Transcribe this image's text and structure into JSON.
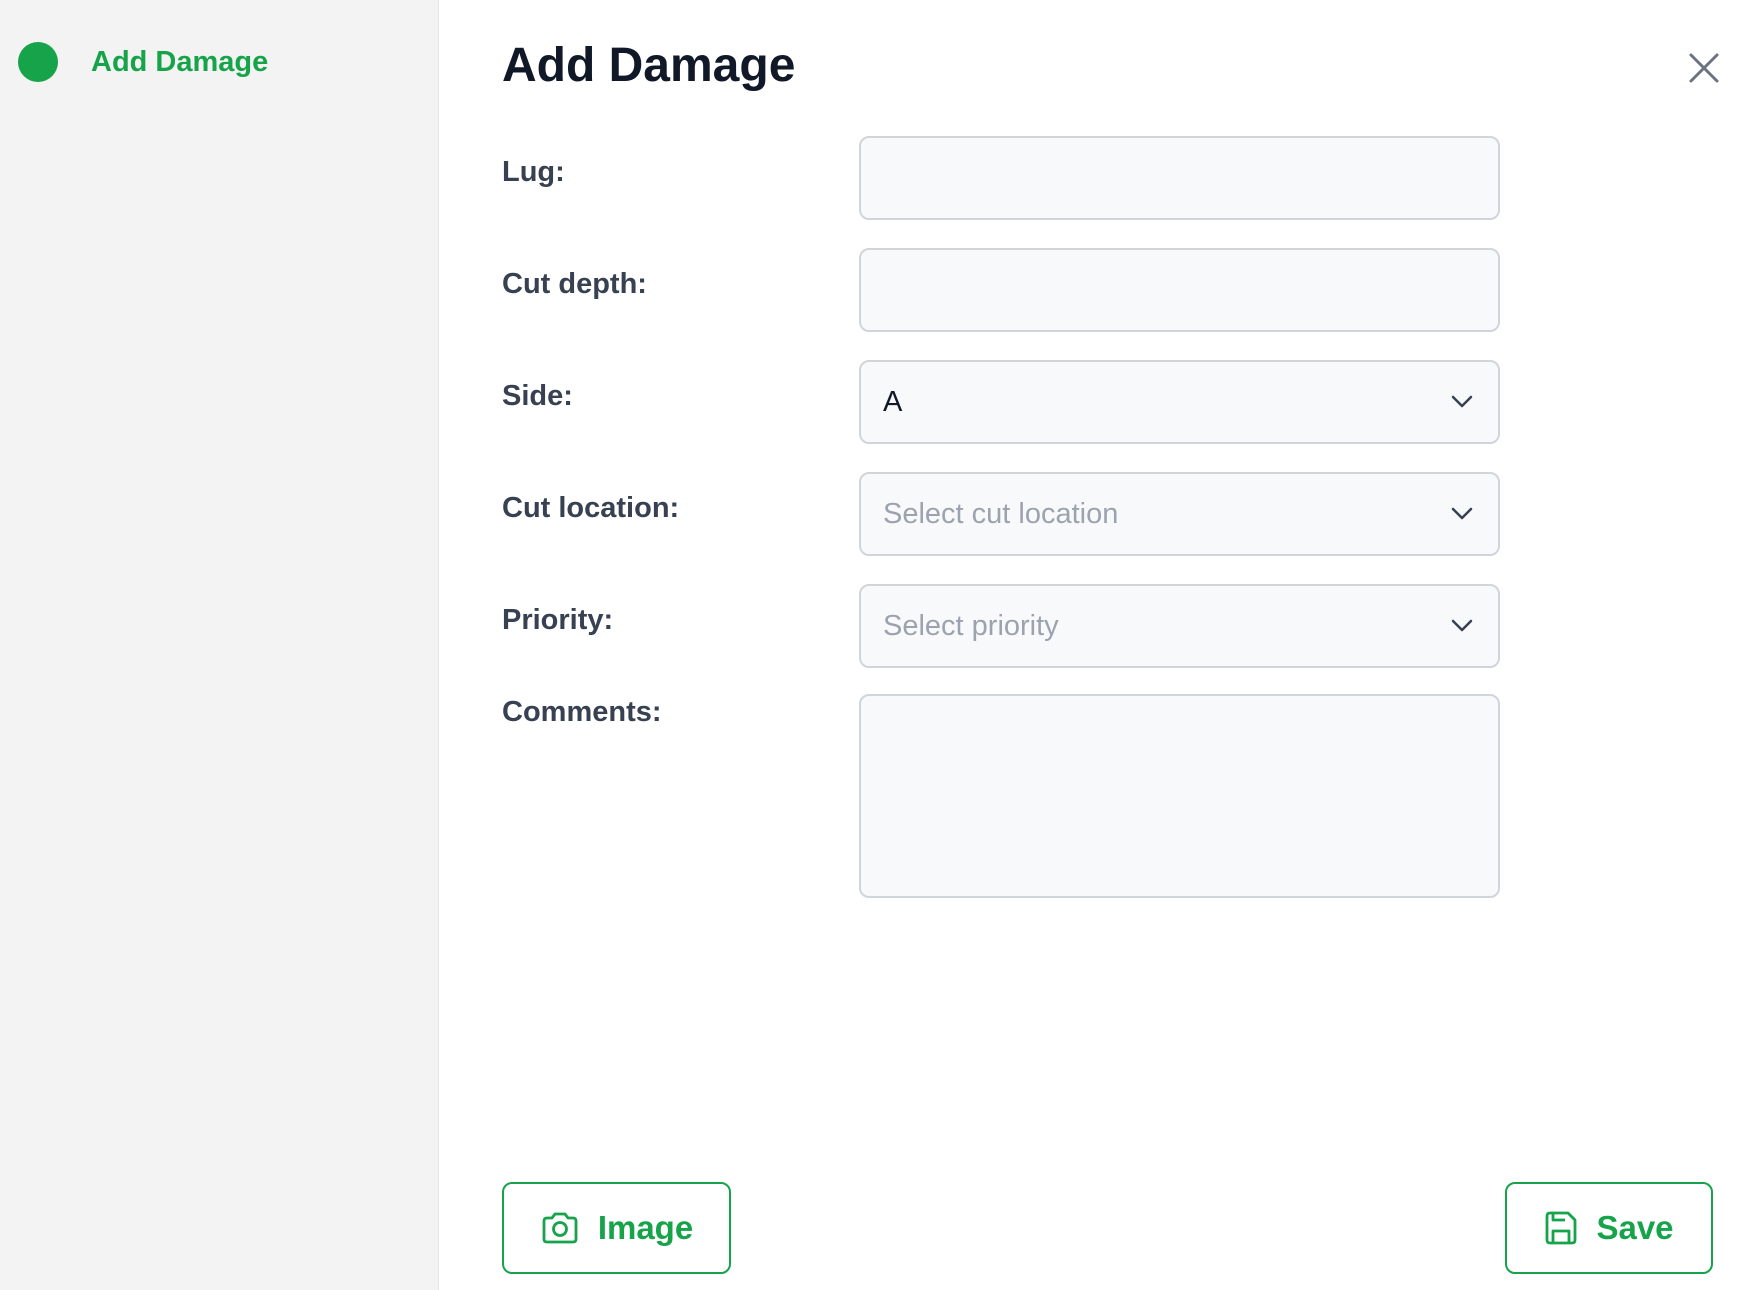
{
  "sidebar": {
    "step_label": "Add Damage",
    "step_color": "#16a34a"
  },
  "header": {
    "title": "Add Damage"
  },
  "form": {
    "lug": {
      "label": "Lug:",
      "value": "",
      "placeholder": ""
    },
    "cut_depth": {
      "label": "Cut depth:",
      "value": "",
      "placeholder": ""
    },
    "side": {
      "label": "Side:",
      "value": "A"
    },
    "cut_location": {
      "label": "Cut location:",
      "placeholder": "Select cut location"
    },
    "priority": {
      "label": "Priority:",
      "placeholder": "Select priority"
    },
    "comments": {
      "label": "Comments:",
      "value": ""
    }
  },
  "actions": {
    "image_label": "Image",
    "save_label": "Save"
  },
  "icons": {
    "close": "close-icon",
    "chevron": "chevron-down-icon",
    "camera": "camera-icon",
    "save": "save-icon"
  },
  "colors": {
    "accent": "#16a34a",
    "sidebar_bg": "#f3f3f3",
    "field_bg": "#f8f9fb",
    "field_border": "#d1d5db",
    "placeholder": "#9ca3af"
  }
}
